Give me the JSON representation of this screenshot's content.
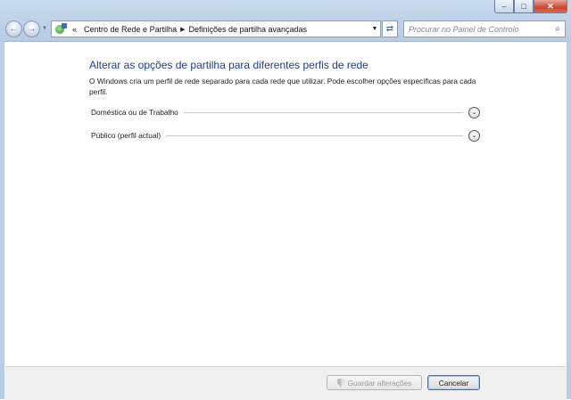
{
  "window": {
    "minimize_glyph": "–",
    "maximize_glyph": "□",
    "close_glyph": "✕"
  },
  "nav": {
    "back_glyph": "←",
    "forward_glyph": "→",
    "history_glyph": "▼",
    "overflow_glyph": "«",
    "breadcrumb": [
      "Centro de Rede e Partilha",
      "Definições de partilha avançadas"
    ],
    "separator_glyph": "▶",
    "dropdown_glyph": "▼",
    "refresh_glyph": "⇄",
    "search_placeholder": "Procurar no Painel de Controlo",
    "search_glyph": "⌕"
  },
  "main": {
    "heading": "Alterar as opções de partilha para diferentes perfis de rede",
    "description": "O Windows cria um perfil de rede separado para cada rede que utilizar. Pode escolher opções específicas para cada perfil.",
    "sections": [
      {
        "label": "Doméstica ou de Trabalho",
        "chevron": "⌄"
      },
      {
        "label": "Público (perfil actual)",
        "chevron": "⌄"
      }
    ]
  },
  "footer": {
    "save_label": "Guardar alterações",
    "cancel_label": "Cancelar"
  },
  "colors": {
    "heading": "#1e3d8f",
    "frame": "#b9cde6",
    "close_button": "#c9482e"
  }
}
